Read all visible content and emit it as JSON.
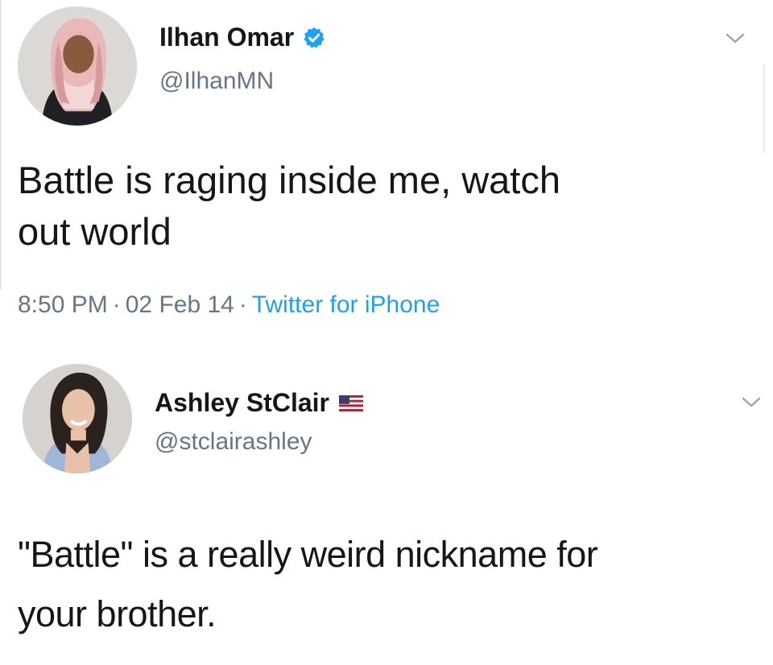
{
  "tweet1": {
    "author": {
      "display_name": "Ilhan Omar",
      "handle": "@IlhanMN",
      "verified_icon": "verified-badge-icon",
      "avatar_icon": "avatar-photo"
    },
    "text_lines": [
      "Battle is raging inside me, watch",
      "out world"
    ],
    "time": "8:50 PM",
    "date": "02 Feb 14",
    "source": "Twitter for iPhone",
    "menu_icon": "chevron-down-icon"
  },
  "tweet2": {
    "author": {
      "display_name": "Ashley StClair",
      "handle": "@stclairashley",
      "flag_icon": "us-flag-icon",
      "avatar_icon": "avatar-photo"
    },
    "text_lines": [
      "\"Battle\" is a really weird nickname for",
      "your brother."
    ],
    "menu_icon": "chevron-down-icon"
  },
  "colors": {
    "text": "#14171a",
    "secondary": "#657786",
    "accent": "#1da1f2"
  }
}
